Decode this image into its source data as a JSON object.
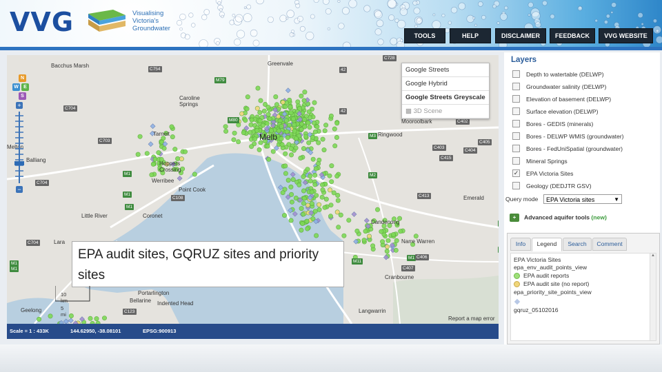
{
  "header": {
    "logo": "VVG",
    "tagline_lines": [
      "Visualising",
      "Victoria's",
      "Groundwater"
    ],
    "nav": [
      "TOOLS",
      "HELP",
      "DISCLAIMER",
      "FEEDBACK",
      "VVG WEBSITE"
    ]
  },
  "map": {
    "basemap_options": [
      "Google Streets",
      "Google Hybrid",
      "Google Streets Greyscale",
      "3D Scene"
    ],
    "basemap_selected": "Google Streets Greyscale",
    "compass": [
      "N",
      "W",
      "E",
      "S"
    ],
    "overlay_caption": "EPA audit sites, GQRUZ sites and priority sites",
    "scale_labels": [
      "10 km",
      "5 mi"
    ],
    "report_link": "Report a map error",
    "places": [
      "Bacchus Marsh",
      "Greenvale",
      "Caroline Springs",
      "Tarneit",
      "Hoppers Crossing",
      "Werribee",
      "Point Cook",
      "Little River",
      "Ringwood",
      "Mooroolbark",
      "Emerald",
      "Dandenong",
      "Narre Warren",
      "Cranbourne",
      "Portarlington",
      "Bellarine",
      "Indented Head",
      "Geelong",
      "Langwarrin",
      "Balliang",
      "Coronet",
      "Lara",
      "Melton"
    ],
    "center_label": "Melb",
    "shields": [
      "C754",
      "M79",
      "M80",
      "C704",
      "C703",
      "C704",
      "M1",
      "C108",
      "C704",
      "M1",
      "C728",
      "C402",
      "C403",
      "C404",
      "C405",
      "C415",
      "M1",
      "C406",
      "C407",
      "M11",
      "C413",
      "C123",
      "M3",
      "42",
      "M1",
      "M1",
      "M1",
      "M1",
      "M1",
      "M2",
      "42"
    ]
  },
  "status": {
    "scale": "Scale = 1 : 433K",
    "coords": "144.62950, -38.08101",
    "epsg": "EPSG:900913"
  },
  "layers_panel": {
    "title": "Layers",
    "layers": [
      {
        "label": "Depth to watertable (DELWP)",
        "checked": false
      },
      {
        "label": "Groundwater salinity (DELWP)",
        "checked": false
      },
      {
        "label": "Elevation of basement (DELWP)",
        "checked": false
      },
      {
        "label": "Surface elevation (DELWP)",
        "checked": false
      },
      {
        "label": "Bores - GEDIS (minerals)",
        "checked": false
      },
      {
        "label": "Bores - DELWP WMIS (groundwater)",
        "checked": false
      },
      {
        "label": "Bores - FedUniSpatial (groundwater)",
        "checked": false
      },
      {
        "label": "Mineral Springs",
        "checked": false
      },
      {
        "label": "EPA Victoria Sites",
        "checked": true
      },
      {
        "label": "Geology (DEDJTR GSV)",
        "checked": false
      }
    ],
    "query_label": "Query mode",
    "query_value": "EPA Victoria sites",
    "advanced_label": "Advanced aquifer tools",
    "advanced_new": "(new)",
    "tabs": [
      "Info",
      "Legend",
      "Search",
      "Comment"
    ],
    "active_tab": "Legend",
    "legend_items": [
      {
        "text": "EPA Victoria Sites",
        "kind": "header"
      },
      {
        "text": "epa_env_audit_points_view",
        "kind": "sub"
      },
      {
        "text": "EPA audit reports",
        "kind": "green"
      },
      {
        "text": "EPA audit site (no report)",
        "kind": "yellow"
      },
      {
        "text": "epa_priority_site_points_view",
        "kind": "sub"
      },
      {
        "text": "",
        "kind": "diamond"
      },
      {
        "text": "gqruz_05102016",
        "kind": "sub"
      }
    ]
  },
  "colors": {
    "brand_blue": "#1c4fa0",
    "statusbar": "#274b8a",
    "point_green": "#7ed957",
    "point_purple": "#a58fd0",
    "point_blue": "#8fb3e6"
  }
}
